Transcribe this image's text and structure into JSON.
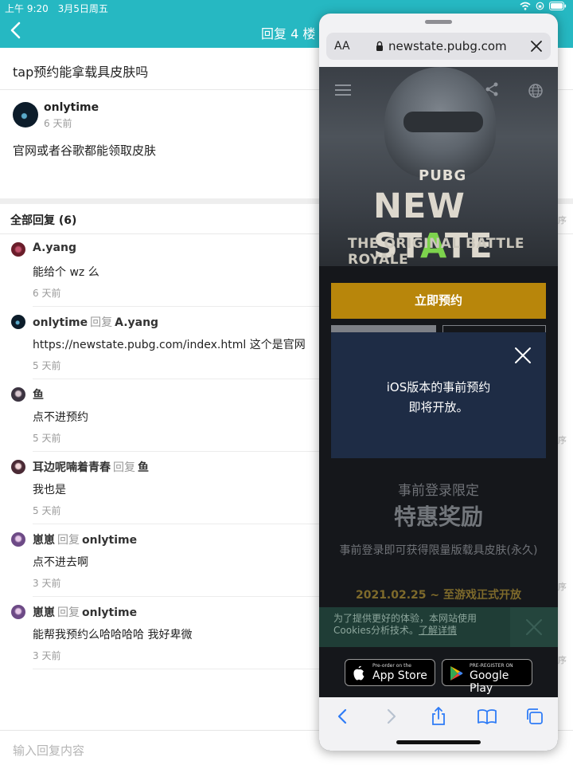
{
  "status_bar": {
    "time": "上午 9:20",
    "date": "3月5日周五"
  },
  "header": {
    "title": "回复 4 楼"
  },
  "question": "tap预约能拿载具皮肤吗",
  "post": {
    "user": "onlytime",
    "time": "6 天前",
    "body": "官网或者谷歌都能领取皮肤"
  },
  "replies_header": "全部回复 (6)",
  "reply_word": "回复",
  "replies": [
    {
      "user": "A.yang",
      "to": "",
      "text": "能给个 wz 么",
      "time": "6 天前"
    },
    {
      "user": "onlytime",
      "to": "A.yang",
      "text": "https://newstate.pubg.com/index.html   这个是官网",
      "time": "5 天前"
    },
    {
      "user": "鱼",
      "to": "",
      "text": "点不进预约",
      "time": "5 天前"
    },
    {
      "user": "耳边呢喃着青春",
      "to": "鱼",
      "text": "我也是",
      "time": "5 天前"
    },
    {
      "user": "崽崽",
      "to": "onlytime",
      "text": "点不进去啊",
      "time": "3 天前"
    },
    {
      "user": "崽崽",
      "to": "onlytime",
      "text": "能帮我预约么哈哈哈哈 我好卑微",
      "time": "3 天前"
    }
  ],
  "input": {
    "placeholder": "输入回复内容"
  },
  "edge_chars": [
    "序",
    "序",
    "序",
    "序"
  ],
  "browser": {
    "aa_label": "AA",
    "url": "newstate.pubg.com",
    "site": {
      "pubg_logo": "PUBG",
      "logo_new": "NEW ST",
      "logo_a": "A",
      "logo_te": "TE",
      "subtitle": "THE ORIGINAL BATTLE ROYALE",
      "preorder_button": "立即预约",
      "modal_line1": "iOS版本的事前预约",
      "modal_line2": "即将开放。",
      "limited": "事前登录限定",
      "reward_title": "特惠奖励",
      "reward_desc": "事前登录即可获得限量版载具皮肤(永久)",
      "date_range": "2021.02.25 ~ 至游戏正式开放",
      "cookie_text": "为了提供更好的体验，本网站使用Cookies分析技术。",
      "cookie_link": "了解详情",
      "appstore_small": "Pre-order on the",
      "appstore_big": "App Store",
      "googleplay_small": "PRE-REGISTER ON",
      "googleplay_big": "Google Play"
    }
  },
  "colors": {
    "accent": "#26b8c2",
    "gold": "#b8860b",
    "modal": "#1e2c45",
    "cookie": "#1f3d36"
  }
}
